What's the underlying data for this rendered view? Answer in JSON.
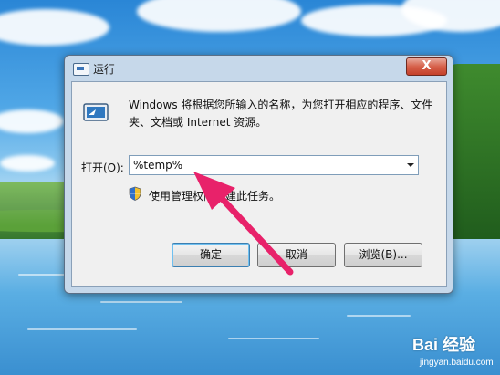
{
  "dialog": {
    "title": "运行",
    "close_symbol": "X",
    "description": "Windows 将根据您所输入的名称，为您打开相应的程序、文件夹、文档或 Internet 资源。",
    "open_label": "打开(O):",
    "command_value": "%temp%",
    "admin_note": "使用管理权限创建此任务。",
    "buttons": {
      "ok": "确定",
      "cancel": "取消",
      "browse": "浏览(B)..."
    }
  },
  "watermark": {
    "brand": "Bai 经验",
    "site": "jingyan.baidu.com"
  },
  "colors": {
    "accent_arrow": "#e8226a",
    "default_button_border": "#3c7fb1"
  },
  "icons": [
    "run-icon",
    "shield-icon",
    "dropdown-arrow-icon",
    "close-icon"
  ]
}
